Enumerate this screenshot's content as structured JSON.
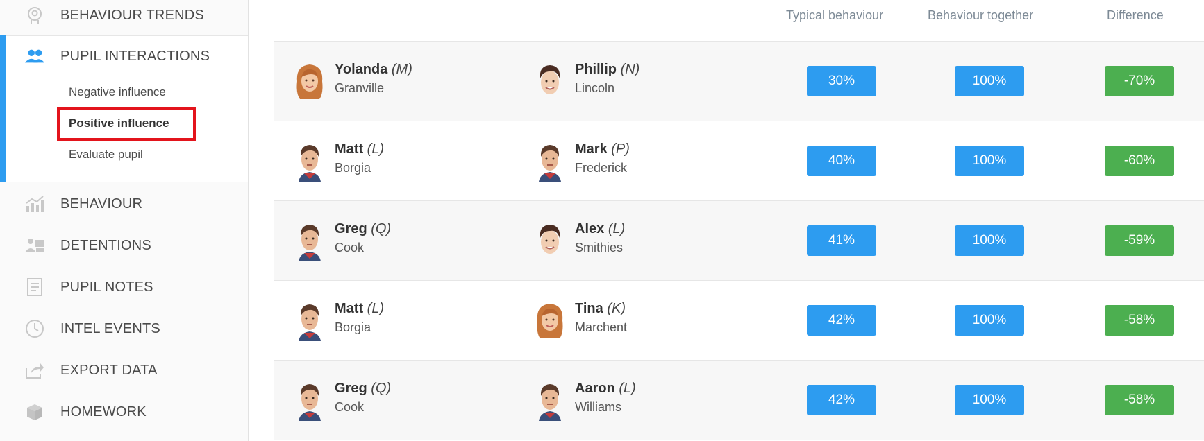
{
  "sidebar": {
    "items_top": [
      {
        "label": "BEHAVIOUR TRENDS",
        "icon": "head-icon"
      }
    ],
    "active": {
      "label": "PUPIL INTERACTIONS",
      "icon": "people-icon",
      "sub_items": [
        "Negative influence",
        "Positive influence",
        "Evaluate pupil"
      ],
      "selected_sub": "Positive influence"
    },
    "items_bottom": [
      {
        "label": "BEHAVIOUR",
        "icon": "chart-icon"
      },
      {
        "label": "DETENTIONS",
        "icon": "detention-icon"
      },
      {
        "label": "PUPIL NOTES",
        "icon": "notes-icon"
      },
      {
        "label": "INTEL EVENTS",
        "icon": "clock-icon"
      },
      {
        "label": "EXPORT DATA",
        "icon": "export-icon"
      },
      {
        "label": "HOMEWORK",
        "icon": "box-icon"
      }
    ]
  },
  "table": {
    "headers": {
      "typical": "Typical behaviour",
      "together": "Behaviour together",
      "difference": "Difference"
    },
    "rows": [
      {
        "p1": {
          "first": "Yolanda",
          "tag": "(M)",
          "last": "Granville",
          "avatar": "female"
        },
        "p2": {
          "first": "Phillip",
          "tag": "(N)",
          "last": "Lincoln",
          "avatar": "male-smile"
        },
        "typical": "30%",
        "together": "100%",
        "difference": "-70%"
      },
      {
        "p1": {
          "first": "Matt",
          "tag": "(L)",
          "last": "Borgia",
          "avatar": "male"
        },
        "p2": {
          "first": "Mark",
          "tag": "(P)",
          "last": "Frederick",
          "avatar": "male"
        },
        "typical": "40%",
        "together": "100%",
        "difference": "-60%"
      },
      {
        "p1": {
          "first": "Greg",
          "tag": "(Q)",
          "last": "Cook",
          "avatar": "male"
        },
        "p2": {
          "first": "Alex",
          "tag": "(L)",
          "last": "Smithies",
          "avatar": "male-smile"
        },
        "typical": "41%",
        "together": "100%",
        "difference": "-59%"
      },
      {
        "p1": {
          "first": "Matt",
          "tag": "(L)",
          "last": "Borgia",
          "avatar": "male"
        },
        "p2": {
          "first": "Tina",
          "tag": "(K)",
          "last": "Marchent",
          "avatar": "female"
        },
        "typical": "42%",
        "together": "100%",
        "difference": "-58%"
      },
      {
        "p1": {
          "first": "Greg",
          "tag": "(Q)",
          "last": "Cook",
          "avatar": "male"
        },
        "p2": {
          "first": "Aaron",
          "tag": "(L)",
          "last": "Williams",
          "avatar": "male"
        },
        "typical": "42%",
        "together": "100%",
        "difference": "-58%"
      }
    ]
  },
  "colors": {
    "accent": "#2d9cf0",
    "positive_pill": "#4caf50",
    "highlight": "#e3141c"
  }
}
